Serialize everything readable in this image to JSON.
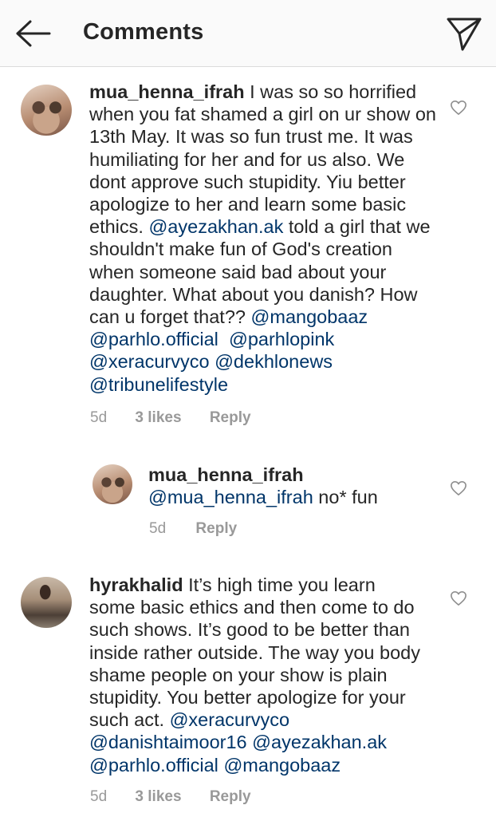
{
  "header": {
    "title": "Comments",
    "back_icon": "arrow-left-icon",
    "share_icon": "paper-plane-icon"
  },
  "comments": [
    {
      "username": "mua_henna_ifrah",
      "text_parts": [
        " I was so so horrified when you fat shamed a girl on ur show on 13th May. It was so fun trust me. It was humiliating for her and for us also. We dont approve such stupidity. Yiu better apologize to her and learn some basic ethics. ",
        "@ayezakhan.ak",
        " told a girl that we shouldn't make fun of God's creation when someone said bad about your daughter. What about you danish? How can u forget that?? ",
        "@mangobaaz",
        "@parhlo.official",
        "@parhlopink",
        "@xeracurvyco",
        "@dekhlonews",
        "@tribunelifestyle"
      ],
      "time": "5d",
      "likes": "3 likes",
      "reply": "Reply"
    },
    {
      "username": "mua_henna_ifrah",
      "text_parts": [
        "@mua_henna_ifrah",
        " no* fun"
      ],
      "time": "5d",
      "reply": "Reply"
    },
    {
      "username": "hyrakhalid",
      "text_parts": [
        " It’s high time you learn some basic ethics and then come to do such shows. It’s good to be better than inside rather outside. The way you body shame people on your show is plain stupidity. You better apologize for your such act. ",
        "@xeracurvyco",
        "@danishtaimoor16",
        "@ayezakhan.ak",
        "@parhlo.official",
        "@mangobaaz"
      ],
      "time": "5d",
      "likes": "3 likes",
      "reply": "Reply"
    }
  ],
  "icons": {
    "like": "heart-outline-icon"
  },
  "colors": {
    "mention": "#003569",
    "meta": "#999999",
    "header_bg": "#fafafa"
  }
}
